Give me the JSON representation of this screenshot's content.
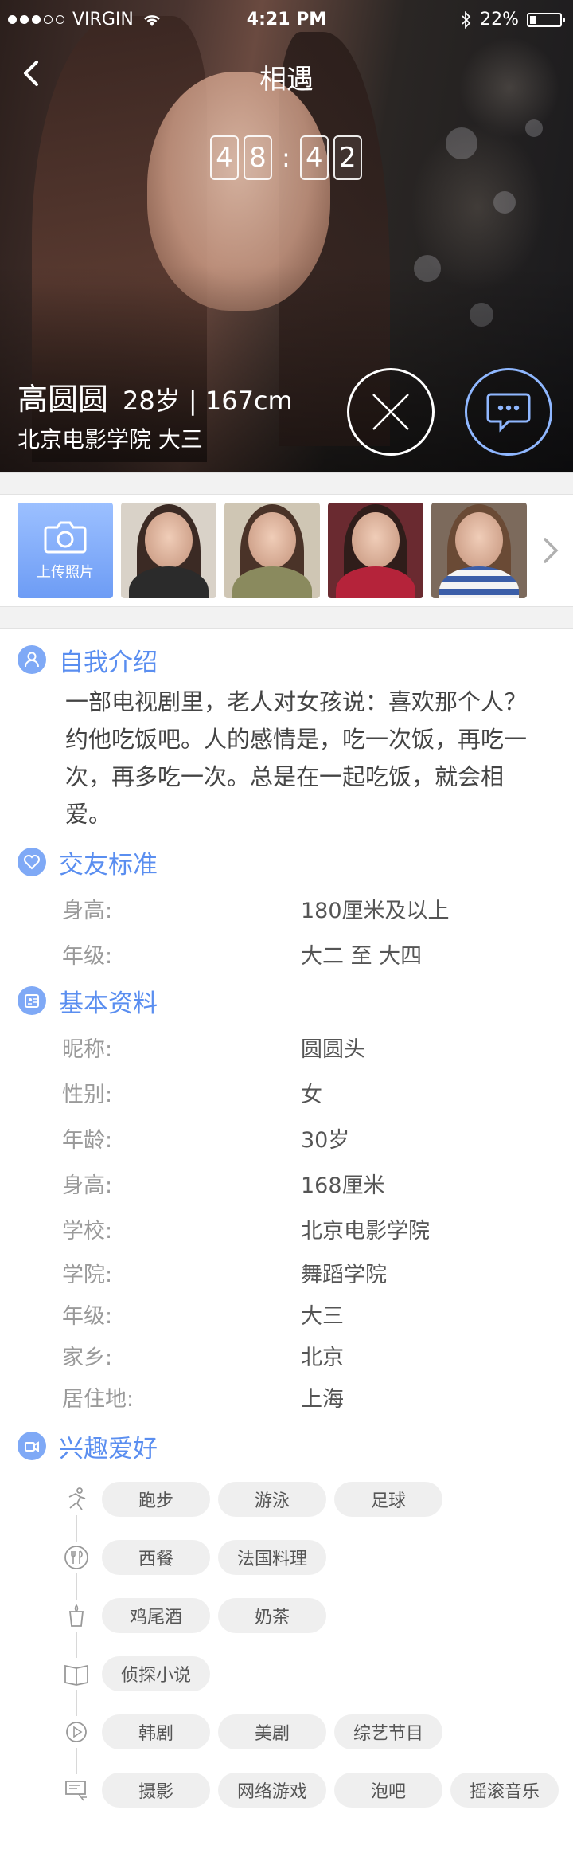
{
  "status_bar": {
    "carrier": "VIRGIN",
    "time": "4:21 PM",
    "battery": "22%",
    "battery_level": 0.22
  },
  "nav": {
    "title": "相遇"
  },
  "countdown": {
    "digits": [
      "4",
      "8",
      "4",
      "2"
    ],
    "separator": ":"
  },
  "profile": {
    "name": "高圆圆",
    "age_height": "28岁 | 167cm",
    "school_year": "北京电影学院 大三"
  },
  "actions": {
    "dislike_icon": "close-icon",
    "chat_icon": "chat-bubble-icon"
  },
  "photos": {
    "upload_label": "上传照片",
    "thumb_count": 4
  },
  "intro": {
    "title": "自我介绍",
    "text": "一部电视剧里，老人对女孩说：喜欢那个人？约他吃饭吧。人的感情是，吃一次饭，再吃一次，再多吃一次。总是在一起吃饭，就会相爱。"
  },
  "criteria": {
    "title": "交友标准",
    "rows": [
      {
        "k": "身高:",
        "v": "180厘米及以上"
      },
      {
        "k": "年级:",
        "v": "大二 至 大四"
      }
    ]
  },
  "basic": {
    "title": "基本资料",
    "rows": [
      {
        "k": "昵称:",
        "v": "圆圆头"
      },
      {
        "k": "性别:",
        "v": "女"
      },
      {
        "k": "年龄:",
        "v": "30岁"
      },
      {
        "k": "身高:",
        "v": "168厘米"
      },
      {
        "k": "学校:",
        "v": "北京电影学院"
      },
      {
        "k": "学院:",
        "v": "舞蹈学院"
      },
      {
        "k": "年级:",
        "v": "大三"
      },
      {
        "k": "家乡:",
        "v": "北京"
      },
      {
        "k": "居住地:",
        "v": "上海"
      }
    ]
  },
  "hobbies": {
    "title": "兴趣爱好",
    "rows": [
      {
        "icon": "sport-icon",
        "tags": [
          "跑步",
          "游泳",
          "足球"
        ]
      },
      {
        "icon": "food-icon",
        "tags": [
          "西餐",
          "法国料理"
        ]
      },
      {
        "icon": "drink-icon",
        "tags": [
          "鸡尾酒",
          "奶茶"
        ]
      },
      {
        "icon": "book-icon",
        "tags": [
          "侦探小说"
        ]
      },
      {
        "icon": "play-icon",
        "tags": [
          "韩剧",
          "美剧",
          "综艺节目"
        ]
      },
      {
        "icon": "entertainment-icon",
        "tags": [
          "摄影",
          "网络游戏",
          "泡吧",
          "摇滚音乐"
        ]
      }
    ]
  },
  "colors": {
    "accent": "#5a8ef0",
    "icon_bg": "#7fa9f6",
    "tag_bg": "#efefef"
  }
}
